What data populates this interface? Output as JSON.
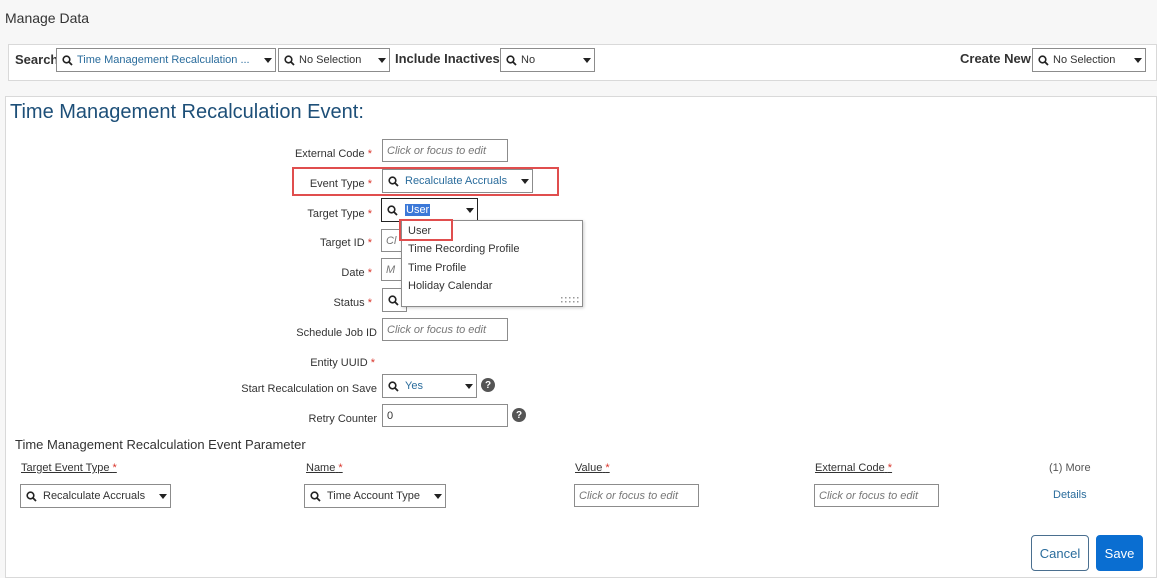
{
  "page": {
    "title": "Manage Data"
  },
  "search_bar": {
    "search_label": "Search",
    "search_object": "Time Management Recalculation ...",
    "search_instance": "No Selection",
    "inactives_label": "Include Inactives:",
    "inactives_value": "No",
    "create_label": "Create New",
    "create_value": "No Selection"
  },
  "form": {
    "title": "Time Management Recalculation Event:",
    "required_mark": "*",
    "fields": {
      "external_code": {
        "label": "External Code",
        "placeholder": "Click or focus to edit"
      },
      "event_type": {
        "label": "Event Type",
        "value": "Recalculate Accruals"
      },
      "target_type": {
        "label": "Target Type",
        "value": "User"
      },
      "target_id": {
        "label": "Target ID",
        "partial": "Cl"
      },
      "date": {
        "label": "Date",
        "partial": "M"
      },
      "status": {
        "label": "Status"
      },
      "schedule_job_id": {
        "label": "Schedule Job ID",
        "placeholder": "Click or focus to edit"
      },
      "entity_uuid": {
        "label": "Entity UUID"
      },
      "start_recalc": {
        "label": "Start Recalculation on Save",
        "value": "Yes"
      },
      "retry_counter": {
        "label": "Retry Counter",
        "value": "0"
      }
    },
    "help_glyph": "?",
    "target_type_options": [
      "User",
      "Time Recording Profile",
      "Time Profile",
      "Holiday Calendar"
    ]
  },
  "params": {
    "title": "Time Management Recalculation Event Parameter",
    "columns": {
      "target_event_type": "Target Event Type",
      "name": "Name",
      "value": "Value",
      "external_code": "External Code",
      "more": "(1) More"
    },
    "row": {
      "target_event_type": "Recalculate Accruals",
      "name": "Time Account Type",
      "value_placeholder": "Click or focus to edit",
      "external_code_placeholder": "Click or focus to edit",
      "details": "Details"
    }
  },
  "actions": {
    "cancel": "Cancel",
    "save": "Save"
  },
  "colors": {
    "accent": "#0a6ed1",
    "title_blue": "#1d4f78",
    "required": "#d9352b",
    "highlight_box": "#e04e4e"
  }
}
